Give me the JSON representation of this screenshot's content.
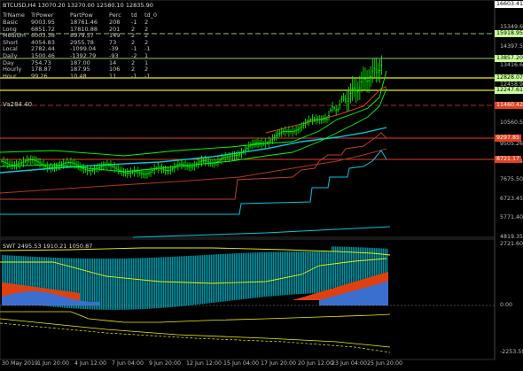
{
  "header": {
    "symbol_text": "BTCUSD,H4  13070.20 13270.00 12580.10 12835.90"
  },
  "table": {
    "columns": [
      "TrName",
      "TrPower",
      "PartPow",
      "Perc",
      "td",
      "td_0"
    ],
    "rows": [
      [
        "Basic",
        "9003.95",
        "18761.46",
        "208",
        "-1",
        "2"
      ],
      [
        "Long",
        "6851.72",
        "17810.88",
        "201",
        "2",
        "2"
      ],
      [
        "Medium",
        "6003.38",
        "8979.57",
        "149",
        "2",
        "2"
      ],
      [
        "Short",
        "4054.83",
        "2955.78",
        "73",
        "2",
        "2"
      ],
      [
        "Local",
        "2782.44",
        "-1099.04",
        "-39",
        "-1",
        "-1"
      ],
      [
        "Daily",
        "1500.46",
        "-1392.79",
        "-93",
        "-2",
        "1"
      ],
      [
        "Day",
        "754.73",
        "187.00",
        "14",
        "2",
        "1"
      ],
      [
        "Hourly",
        "178.87",
        "187.95",
        "106",
        "2",
        "2"
      ],
      [
        "Hour",
        "99.26",
        "10.48",
        "11",
        "-1",
        "-1"
      ]
    ]
  },
  "va_text": "Va284.40",
  "indicator": {
    "label": "SWT 2495.53 1910.21 1050.87"
  },
  "price_scale": [
    "16603.41",
    "15349.60",
    "14397.55",
    "13416.65",
    "12458.98",
    "10560.50",
    "9505.26",
    "8550.04",
    "7675.50",
    "6723.45",
    "5771.40",
    "4819.35"
  ],
  "price_labels": [
    {
      "text": "16603.41",
      "bg": "#ffffff",
      "fg": "#000000"
    },
    {
      "text": "15918.95",
      "bg": "#c8ff9a",
      "fg": "#000000"
    },
    {
      "text": "13857.20",
      "bg": "#c8ff9a",
      "fg": "#000000"
    },
    {
      "text": "12828.07",
      "bg": "#c8ff9a",
      "fg": "#000000"
    },
    {
      "text": "12247.61",
      "bg": "#c8ff9a",
      "fg": "#000000"
    },
    {
      "text": "11460.42",
      "bg": "#e04020",
      "fg": "#ffffff"
    },
    {
      "text": "9297.85",
      "bg": "#e04020",
      "fg": "#ffffff"
    },
    {
      "text": "8721.17",
      "bg": "#e04020",
      "fg": "#ffffff"
    }
  ],
  "indicator_scale": [
    "2721.60",
    "0.00",
    "-2253.59"
  ],
  "time_labels": [
    "30 May 2019",
    "1 Jun 20:00",
    "4 Jun 12:00",
    "7 Jun 04:00",
    "9 Jun 20:00",
    "12 Jun 12:00",
    "15 Jun 04:00",
    "17 Jun 20:00",
    "20 Jun 12:00",
    "23 Jun 04:00",
    "25 Jun 20:00"
  ],
  "colors": {
    "background": "#000000",
    "candle": "#00ff00",
    "accent_yellow": "#f0f000",
    "cyan": "#00c8e0",
    "red": "#e04020"
  }
}
